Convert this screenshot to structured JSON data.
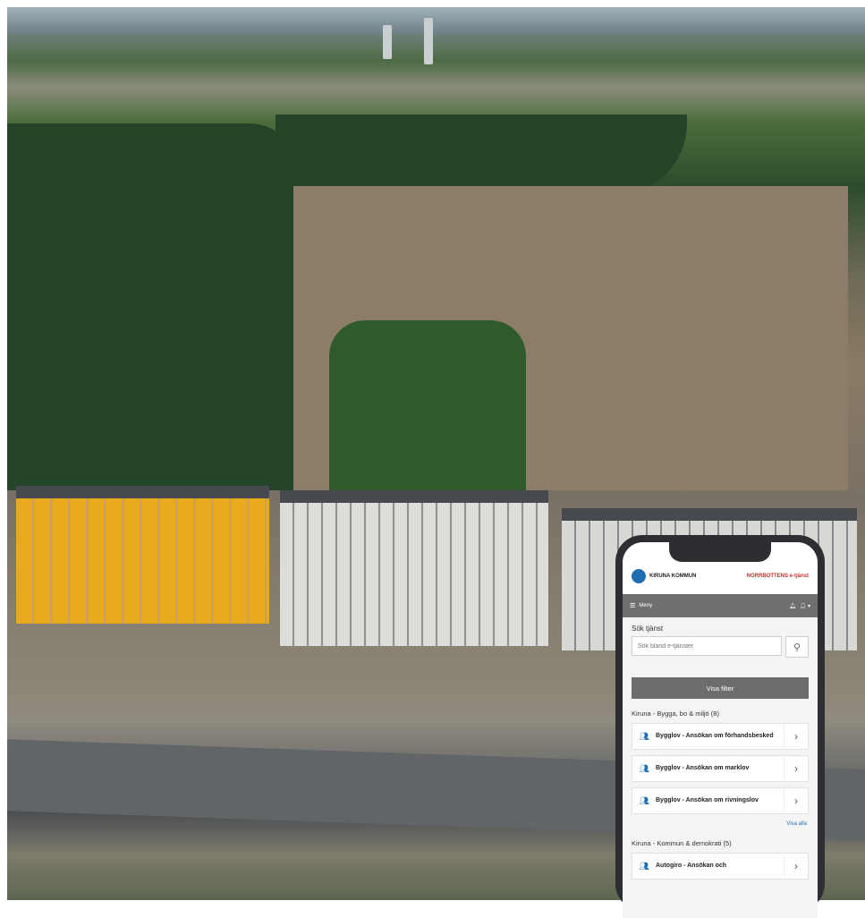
{
  "app": {
    "kommun_name": "KIRUNA KOMMUN",
    "brand_name": "NORRBOTTENS e-tjänst"
  },
  "menubar": {
    "menu_label": "Meny"
  },
  "search": {
    "label": "Sök tjänst",
    "placeholder": "Sök bland e-tjänster"
  },
  "filter": {
    "button_label": "Visa filter"
  },
  "categories": [
    {
      "title": "Kiruna - Bygga, bo & miljö (8)",
      "services": [
        {
          "title": "Bygglov - Ansökan om förhandsbesked"
        },
        {
          "title": "Bygglov - Ansökan om marklov"
        },
        {
          "title": "Bygglov - Ansökan om rivningslov"
        }
      ],
      "show_all": "Visa alla"
    },
    {
      "title": "Kiruna - Kommun & demokrati (5)",
      "services": [
        {
          "title": "Autogiro - Ansökan och"
        }
      ]
    }
  ],
  "colors": {
    "accent": "#1f6eb3",
    "menubar": "#6f6f6f",
    "brand_red": "#c2322b"
  }
}
